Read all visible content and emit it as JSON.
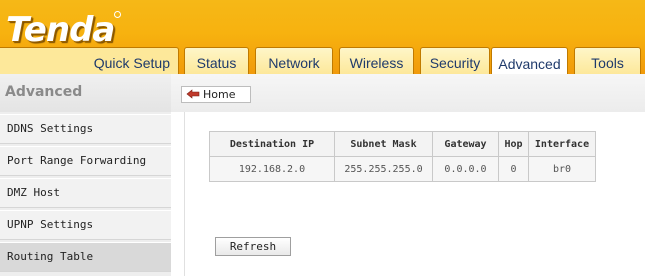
{
  "brand": {
    "logo_text": "Tenda"
  },
  "tabs": [
    {
      "label": "Quick Setup"
    },
    {
      "label": "Status"
    },
    {
      "label": "Network"
    },
    {
      "label": "Wireless"
    },
    {
      "label": "Security"
    },
    {
      "label": "Advanced",
      "active": true
    },
    {
      "label": "Tools"
    }
  ],
  "sidebar": {
    "title": "Advanced",
    "items": [
      {
        "label": "DDNS Settings"
      },
      {
        "label": "Port Range Forwarding"
      },
      {
        "label": "DMZ Host"
      },
      {
        "label": "UPNP Settings"
      },
      {
        "label": "Routing Table",
        "active": true
      }
    ]
  },
  "breadcrumb": {
    "home_label": "Home"
  },
  "routing_table": {
    "columns": [
      "Destination IP",
      "Subnet Mask",
      "Gateway",
      "Hop",
      "Interface"
    ],
    "rows": [
      [
        "192.168.2.0",
        "255.255.255.0",
        "0.0.0.0",
        "0",
        "br0"
      ]
    ]
  },
  "actions": {
    "refresh_label": "Refresh"
  },
  "colors": {
    "header_orange": "#f7b20f",
    "tab_text": "#1f3a6b",
    "active_nav": "#d9d9d9"
  },
  "icons": {
    "home": "home-pointer-icon"
  }
}
